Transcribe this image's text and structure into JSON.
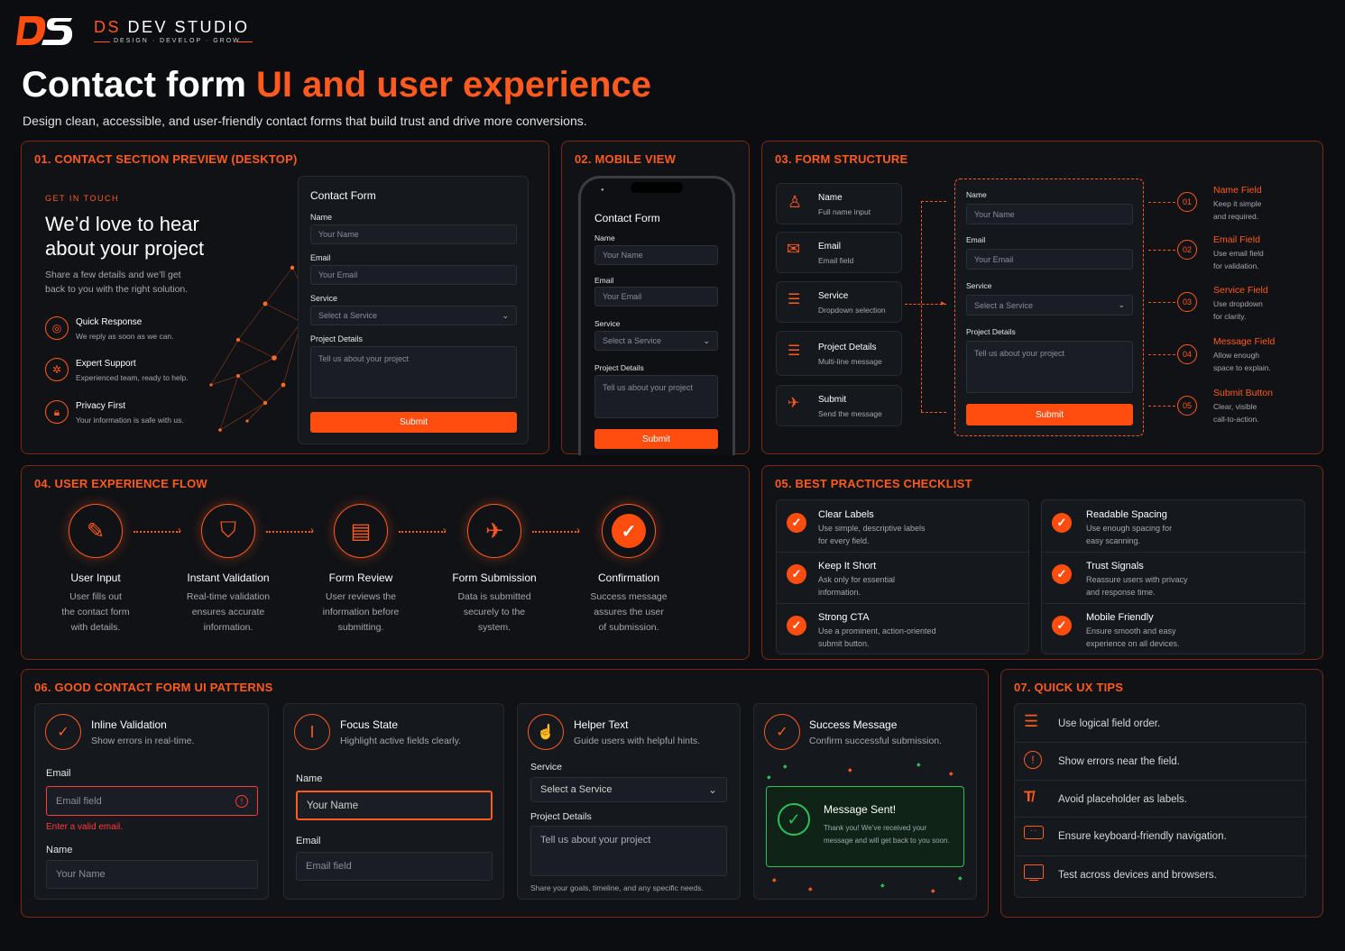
{
  "brand": {
    "logo": "DS",
    "name_prefix": "DS",
    "name": "DEV STUDIO",
    "tagline": "DESIGN · DEVELOP · GROW"
  },
  "header": {
    "title_white": "Contact form ",
    "title_orange": "UI and user experience",
    "subtitle": "Design clean, accessible, and user-friendly contact forms that build trust and drive more conversions."
  },
  "colors": {
    "accent": "#ff5a1f",
    "background": "#0b0d10",
    "success": "#2fbf5a"
  },
  "s1": {
    "title": "01. CONTACT SECTION PREVIEW (DESKTOP)",
    "eyebrow": "GET IN TOUCH",
    "heading_line1": "We’d love to hear",
    "heading_line2": "about your project",
    "desc_line1": "Share a few details and we’ll get",
    "desc_line2": "back to you with the right solution.",
    "features": [
      {
        "icon": "target-icon",
        "title": "Quick Response",
        "desc": "We reply as soon as we can."
      },
      {
        "icon": "support-icon",
        "title": "Expert Support",
        "desc": "Experienced team, ready to help."
      },
      {
        "icon": "lock-icon",
        "title": "Privacy First",
        "desc": "Your information is safe with us."
      }
    ],
    "form": {
      "title": "Contact Form",
      "name_label": "Name",
      "name_ph": "Your Name",
      "email_label": "Email",
      "email_ph": "Your Email",
      "service_label": "Service",
      "service_ph": "Select a Service",
      "details_label": "Project Details",
      "details_ph": "Tell us about your project",
      "submit": "Submit"
    }
  },
  "s2": {
    "title": "02. MOBILE VIEW",
    "form": {
      "title": "Contact Form",
      "name_label": "Name",
      "name_ph": "Your Name",
      "email_label": "Email",
      "email_ph": "Your Email",
      "service_label": "Service",
      "service_ph": "Select a Service",
      "details_label": "Project Details",
      "details_ph": "Tell us about your project",
      "submit": "Submit"
    }
  },
  "s3": {
    "title": "03. FORM STRUCTURE",
    "items": [
      {
        "icon": "user-icon",
        "title": "Name",
        "desc": "Full name input"
      },
      {
        "icon": "mail-icon",
        "title": "Email",
        "desc": "Email field"
      },
      {
        "icon": "sliders-icon",
        "title": "Service",
        "desc": "Dropdown selection"
      },
      {
        "icon": "sliders-icon",
        "title": "Project Details",
        "desc": "Multi-line message"
      },
      {
        "icon": "send-icon",
        "title": "Submit",
        "desc": "Send the message"
      }
    ],
    "form": {
      "name_label": "Name",
      "name_ph": "Your Name",
      "email_label": "Email",
      "email_ph": "Your Email",
      "service_label": "Service",
      "service_ph": "Select a Service",
      "details_label": "Project Details",
      "details_ph": "Tell us about your project",
      "submit": "Submit"
    },
    "notes": [
      {
        "num": "01",
        "title": "Name Field",
        "line1": "Keep it simple",
        "line2": "and required."
      },
      {
        "num": "02",
        "title": "Email Field",
        "line1": "Use email field",
        "line2": "for validation."
      },
      {
        "num": "03",
        "title": "Service Field",
        "line1": "Use dropdown",
        "line2": "for clarity."
      },
      {
        "num": "04",
        "title": "Message Field",
        "line1": "Allow enough",
        "line2": "space to explain."
      },
      {
        "num": "05",
        "title": "Submit Button",
        "line1": "Clear, visible",
        "line2": "call-to-action."
      }
    ]
  },
  "s4": {
    "title": "04. USER EXPERIENCE FLOW",
    "steps": [
      {
        "icon": "edit-icon",
        "title": "User Input",
        "l1": "User fills out",
        "l2": "the contact form",
        "l3": "with details."
      },
      {
        "icon": "shield-check-icon",
        "title": "Instant Validation",
        "l1": "Real-time validation",
        "l2": "ensures accurate",
        "l3": "information."
      },
      {
        "icon": "document-check-icon",
        "title": "Form Review",
        "l1": "User reviews the",
        "l2": "information before",
        "l3": "submitting."
      },
      {
        "icon": "paper-plane-icon",
        "title": "Form Submission",
        "l1": "Data is submitted",
        "l2": "securely to the",
        "l3": "system."
      },
      {
        "icon": "check-circle-icon",
        "title": "Confirmation",
        "l1": "Success message",
        "l2": "assures the user",
        "l3": "of submission."
      }
    ]
  },
  "s5": {
    "title": "05. BEST PRACTICES CHECKLIST",
    "left": [
      {
        "title": "Clear Labels",
        "l1": "Use simple, descriptive labels",
        "l2": "for every field."
      },
      {
        "title": "Keep It Short",
        "l1": "Ask only for essential",
        "l2": "information."
      },
      {
        "title": "Strong CTA",
        "l1": "Use a prominent, action-oriented",
        "l2": "submit button."
      }
    ],
    "right": [
      {
        "title": "Readable Spacing",
        "l1": "Use enough spacing for",
        "l2": "easy scanning."
      },
      {
        "title": "Trust Signals",
        "l1": "Reassure users with privacy",
        "l2": "and response time."
      },
      {
        "title": "Mobile Friendly",
        "l1": "Ensure smooth and easy",
        "l2": "experience on all devices."
      }
    ]
  },
  "s6": {
    "title": "06. GOOD CONTACT FORM UI PATTERNS",
    "inline": {
      "title": "Inline Validation",
      "desc": "Show errors in real-time.",
      "email_label": "Email",
      "email_ph": "Email field",
      "error": "Enter a valid email.",
      "name_label": "Name",
      "name_ph": "Your Name"
    },
    "focus": {
      "title": "Focus State",
      "desc": "Highlight active fields clearly.",
      "name_label": "Name",
      "name_ph": "Your Name",
      "email_label": "Email",
      "email_ph": "Email field"
    },
    "helper": {
      "title": "Helper Text",
      "desc": "Guide users with helpful hints.",
      "service_label": "Service",
      "service_ph": "Select a Service",
      "details_label": "Project Details",
      "details_ph": "Tell us about your project",
      "hint": "Share your goals, timeline, and any specific needs."
    },
    "success": {
      "title": "Success Message",
      "desc": "Confirm successful submission.",
      "msg_title": "Message Sent!",
      "msg_l1": "Thank you! We’ve received your",
      "msg_l2": "message and will get back to you soon."
    }
  },
  "s7": {
    "title": "07. QUICK UX TIPS",
    "tips": [
      {
        "icon": "list-icon",
        "text": "Use logical field order."
      },
      {
        "icon": "alert-icon",
        "text": "Show errors near the field."
      },
      {
        "icon": "text-clear-icon",
        "text": "Avoid placeholder as labels."
      },
      {
        "icon": "keyboard-icon",
        "text": "Ensure keyboard-friendly navigation."
      },
      {
        "icon": "monitor-icon",
        "text": "Test across devices and browsers."
      }
    ]
  }
}
